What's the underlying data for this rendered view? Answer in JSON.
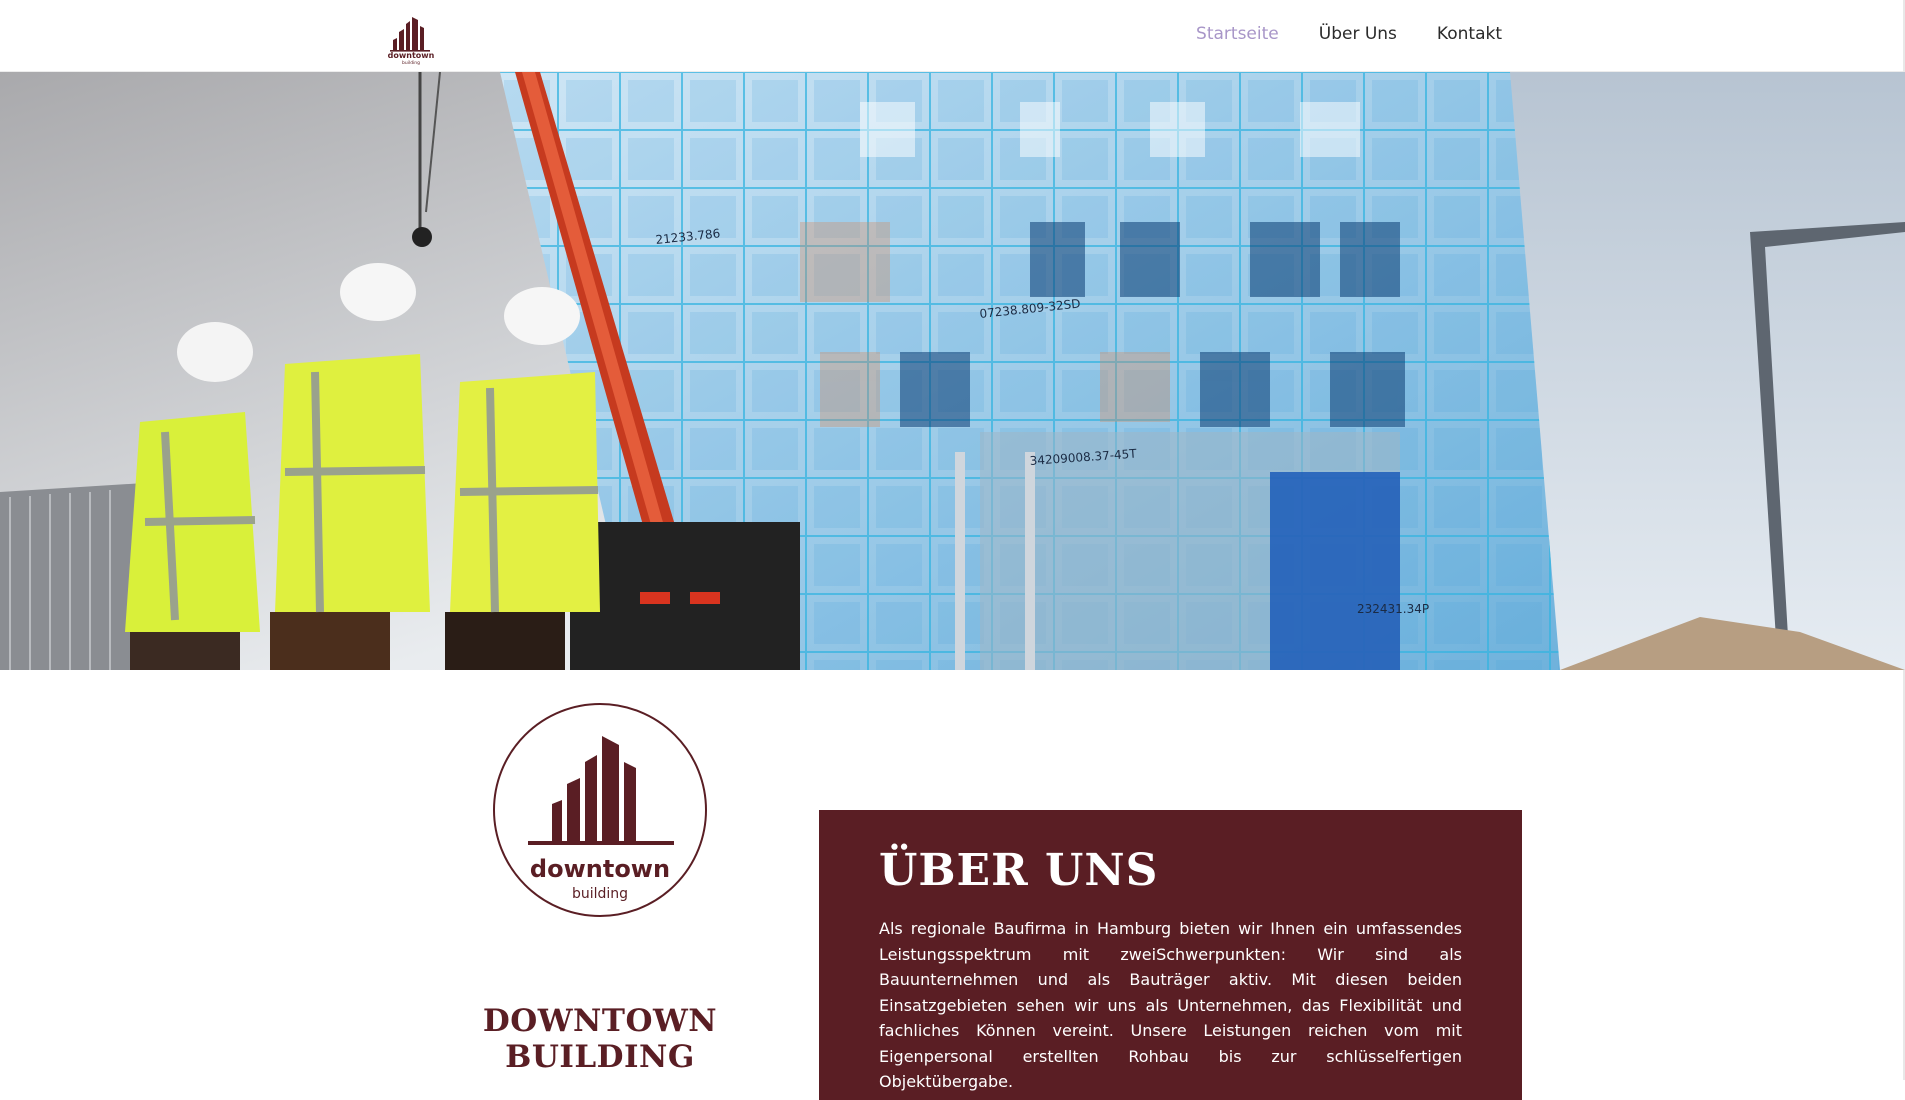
{
  "header": {
    "logo": {
      "icon": "downtown-building-logo",
      "word": "downtown",
      "sub": "building"
    },
    "nav": [
      {
        "label": "Startseite",
        "active": true
      },
      {
        "label": "Über Uns",
        "active": false
      },
      {
        "label": "Kontakt",
        "active": false
      }
    ]
  },
  "hero": {
    "image": "construction-workers-and-building-hologram",
    "overlay_labels": [
      "21233.786",
      "07238.809-32SD",
      "34209008.37-45T",
      "232431.34P"
    ]
  },
  "brand": {
    "logo_word": "downtown",
    "logo_sub": "building",
    "name_line1": "DOWNTOWN",
    "name_line2": "BUILDING"
  },
  "about": {
    "title": "ÜBER UNS",
    "text": "Als regionale Baufirma in Hamburg bieten wir Ihnen ein umfassendes Leistungsspektrum mit zweiSchwerpunkten: Wir sind als Bauunternehmen und als Bauträger aktiv. Mit diesen beiden Einsatzgebieten sehen wir uns als Unternehmen, das Flexibilität und fachliches Können vereint. Unsere Leistungen reichen vom mit Eigenpersonal erstellten Rohbau bis zur schlüsselfertigen Objektübergabe."
  },
  "colors": {
    "brand": "#5a1e24",
    "nav_active": "#a896c8",
    "text": "#2b2b2b",
    "background": "#ffffff"
  }
}
